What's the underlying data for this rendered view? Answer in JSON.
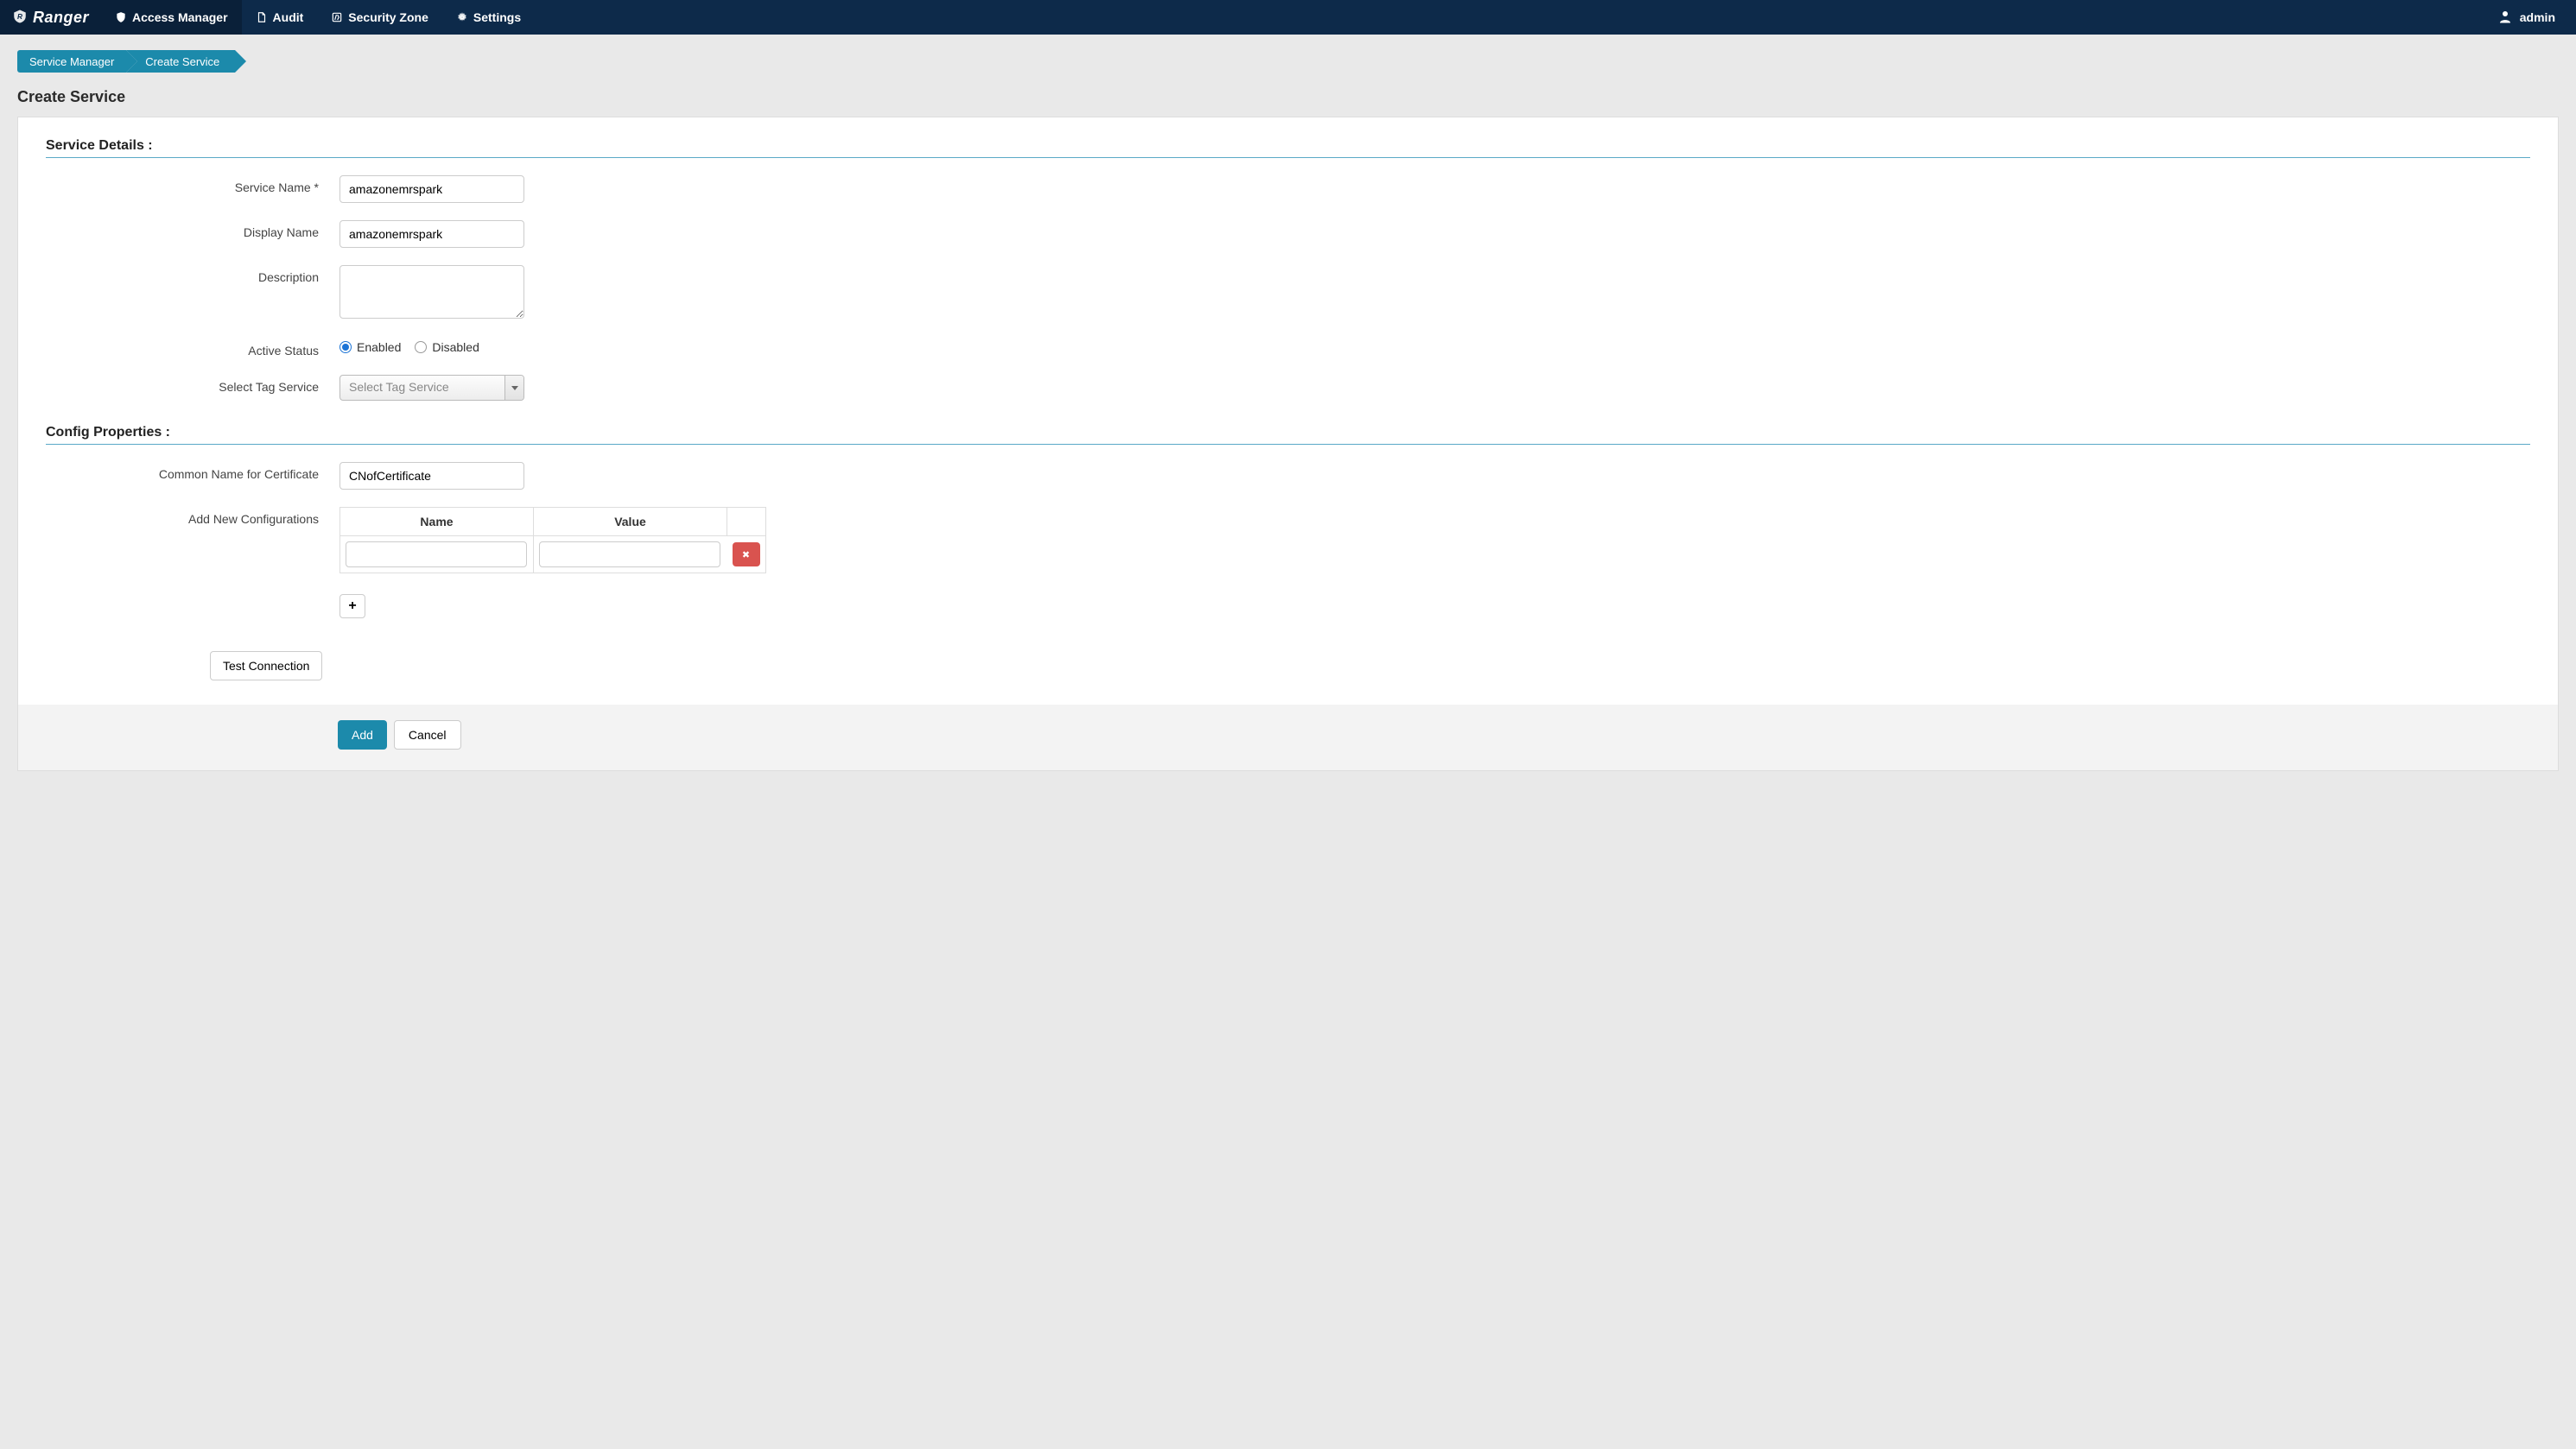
{
  "brand": "Ranger",
  "nav": {
    "items": [
      {
        "label": "Access Manager"
      },
      {
        "label": "Audit"
      },
      {
        "label": "Security Zone"
      },
      {
        "label": "Settings"
      }
    ]
  },
  "user": "admin",
  "breadcrumb": [
    "Service Manager",
    "Create Service"
  ],
  "page_title": "Create Service",
  "sections": {
    "service_details": "Service Details :",
    "config_props": "Config Properties :"
  },
  "fields": {
    "service_name": {
      "label": "Service Name *",
      "value": "amazonemrspark"
    },
    "display_name": {
      "label": "Display Name",
      "value": "amazonemrspark"
    },
    "description": {
      "label": "Description",
      "value": ""
    },
    "active_status": {
      "label": "Active Status",
      "enabled_label": "Enabled",
      "disabled_label": "Disabled",
      "selected": "Enabled"
    },
    "tag_service": {
      "label": "Select Tag Service",
      "placeholder": "Select Tag Service"
    },
    "common_name": {
      "label": "Common Name for Certificate",
      "value": "CNofCertificate"
    },
    "add_configs": {
      "label": "Add New Configurations",
      "columns": {
        "name": "Name",
        "value": "Value"
      },
      "rows": [
        {
          "name": "",
          "value": ""
        }
      ]
    }
  },
  "buttons": {
    "test_connection": "Test Connection",
    "add": "Add",
    "cancel": "Cancel",
    "plus": "+",
    "delete_icon": "✖"
  }
}
